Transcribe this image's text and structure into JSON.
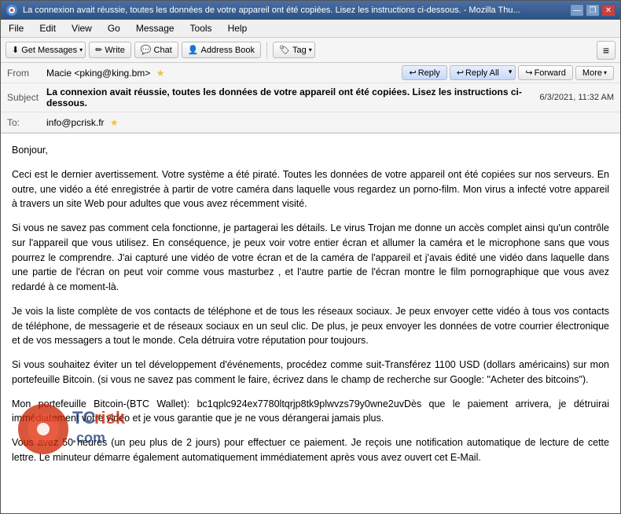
{
  "window": {
    "title": "La connexion avait réussie, toutes les données de votre appareil ont été copiées. Lisez les instructions ci-dessous. - Mozilla Thu...",
    "controls": {
      "minimize": "—",
      "restore": "❐",
      "close": "✕"
    }
  },
  "menu": {
    "items": [
      "File",
      "Edit",
      "View",
      "Go",
      "Message",
      "Tools",
      "Help"
    ]
  },
  "toolbar": {
    "get_messages": "Get Messages",
    "write": "Write",
    "chat": "Chat",
    "address_book": "Address Book",
    "tag": "Tag",
    "hamburger": "≡"
  },
  "email_header": {
    "from_label": "From",
    "from_value": "Macie <pking@king.bm>",
    "subject_label": "Subject",
    "subject_value": "La connexion avait réussie, toutes les données de votre appareil ont été copiées. Lisez les instructions ci-dessous.",
    "date_value": "6/3/2021, 11:32 AM",
    "to_label": "To:",
    "to_value": "info@pcrisk.fr",
    "reply_label": "Reply",
    "reply_all_label": "Reply All",
    "forward_label": "Forward",
    "more_label": "More"
  },
  "email_body": {
    "paragraph1": "Bonjour,",
    "paragraph2": "Ceci est le dernier avertissement. Votre système a été piraté. Toutes les données de votre appareil ont été copiées sur nos serveurs. En outre, une vidéo a été enregistrée à partir de votre caméra dans laquelle vous regardez un porno-film. Mon virus a infecté votre appareil à travers un site Web pour adultes que vous avez récemment visité.",
    "paragraph3": "Si vous ne savez pas comment cela fonctionne, je partagerai les détails. Le virus Trojan me donne un accès complet ainsi qu'un contrôle sur l'appareil que vous utilisez. En conséquence, je peux voir votre entier écran et allumer la caméra et le microphone sans que vous pourrez le comprendre. J'ai capturé une vidéo de votre écran et de la caméra de l'appareil et j'avais édité une vidéo dans laquelle dans une partie de l'écran on peut voir comme vous masturbez , et l'autre partie de l'écran montre le film pornographique que vous avez redardé à ce moment-là.",
    "paragraph4": "Je vois la liste complète de vos contacts de téléphone et de tous les réseaux sociaux. Je peux envoyer cette vidéo à tous vos contacts de téléphone, de messagerie et de réseaux sociaux en un seul clic. De plus, je peux envoyer les données de votre courrier électronique et de vos messagers a tout le monde. Cela détruira votre réputation pour toujours.",
    "paragraph5": "Si vous souhaitez éviter un tel développement d'événements, procédez comme suit-Transférez 1100 USD (dollars américains) sur mon portefeuille Bitcoin. (si vous ne savez pas comment le faire, écrivez dans le champ de recherche sur Google: \"Acheter des bitcoins\").",
    "paragraph6": "Mon portefeuille Bitcoin-(BTC Wallet): bc1qplc924ex7780ltqrjp8tk9plwvzs79y0wne2uvDès que le paiement arrivera, je détruirai immédiatement votre vidéo et je vous garantie que je ne vous dérangerai jamais plus.",
    "paragraph7": "Vous avez 50 heures (un peu plus de 2 jours) pour effectuer ce paiement. Je reçois une notification automatique de lecture de cette lettre. Le minuteur démarre également automatiquement immédiatement après vous avez ouvert cet E-Mail."
  }
}
